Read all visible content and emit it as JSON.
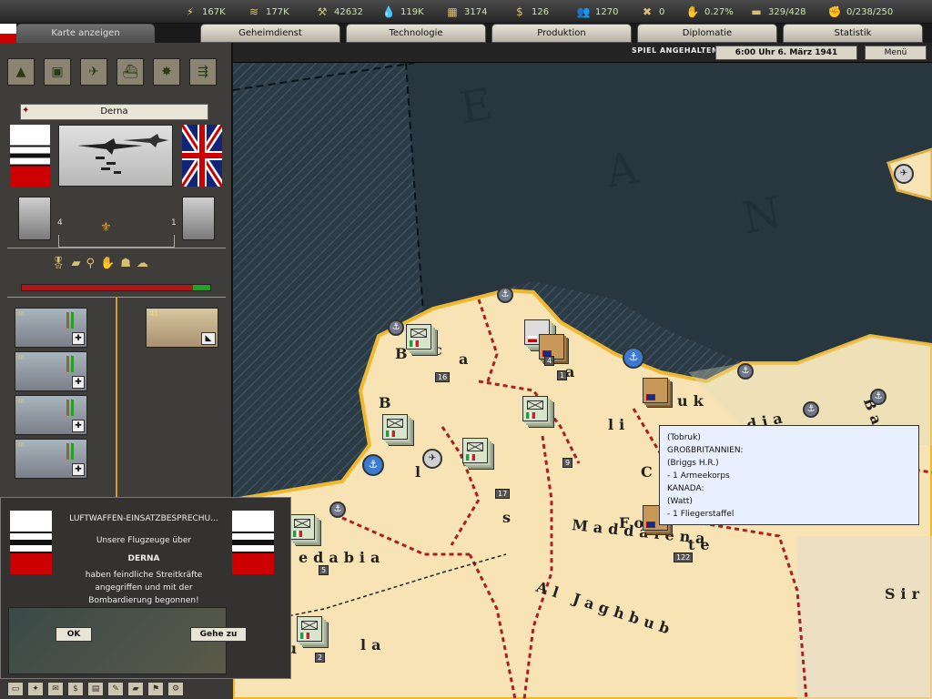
{
  "resources": [
    {
      "icon": "energy-icon",
      "glyph": "⚡",
      "value": "167K"
    },
    {
      "icon": "metal-icon",
      "glyph": "≋",
      "value": "177K"
    },
    {
      "icon": "rare-materials-icon",
      "glyph": "⚒",
      "value": "42632"
    },
    {
      "icon": "oil-icon",
      "glyph": "💧",
      "value": "119K"
    },
    {
      "icon": "supplies-icon",
      "glyph": "▦",
      "value": "3174"
    },
    {
      "icon": "money-icon",
      "glyph": "$",
      "value": "126"
    },
    {
      "icon": "manpower-icon",
      "glyph": "👥",
      "value": "1270"
    },
    {
      "icon": "diplomacy-icon",
      "glyph": "✖",
      "value": "0"
    },
    {
      "icon": "dissent-icon",
      "glyph": "✋",
      "value": "0.27%"
    },
    {
      "icon": "transport-icon",
      "glyph": "▬",
      "value": "329/428"
    },
    {
      "icon": "convoy-icon",
      "glyph": "✊",
      "value": "0/238/250"
    }
  ],
  "tabs": [
    "Karte anzeigen",
    "Geheimdienst",
    "Technologie",
    "Produktion",
    "Diplomatie",
    "Statistik"
  ],
  "status": {
    "paused": "SPIEL ANGEHALTEN",
    "clock": "6:00 Uhr 6. März 1941",
    "menu": "Menü"
  },
  "map_modes": [
    "terrain-map-icon",
    "land-unit-map-icon",
    "air-map-icon",
    "naval-map-icon",
    "bombing-map-icon",
    "supply-map-icon"
  ],
  "panel": {
    "province": "Derna",
    "left_leader_count": "4",
    "right_leader_count": "1",
    "air_units": [
      {
        "level": "III"
      },
      {
        "level": "III"
      },
      {
        "level": "III"
      },
      {
        "level": "III"
      }
    ],
    "infantry": {
      "strength": "41"
    },
    "hp_fraction": 0.91
  },
  "map": {
    "sea_letters": [
      "E",
      "A",
      "N"
    ],
    "regions": [
      "B",
      "c",
      "a",
      "a",
      "B",
      "l",
      "i",
      "li",
      "s",
      "C",
      "uk",
      "dia",
      "Fo",
      "te",
      "Maddalena",
      "edabia",
      "Al Jaghbub",
      "Au",
      "la",
      "Sir",
      "Ba"
    ],
    "unit_counts": [
      "16",
      "1",
      "4",
      "9",
      "17",
      "5",
      "122",
      "2"
    ]
  },
  "tooltip": [
    "(Tobruk)",
    "GROßBRITANNIEN:",
    "(Briggs H.R.)",
    "- 1 Armeekorps",
    "KANADA:",
    "(Watt)",
    "- 1 Fliegerstaffel"
  ],
  "dialog": {
    "title": "LUFTWAFFEN-EINSATZBESPRECHU...",
    "line1": "Unsere Flugzeuge über",
    "province": "DERNA",
    "line2": "haben feindliche Streitkräfte",
    "line3": "angegriffen und mit der",
    "line4": "Bombardierung begonnen!",
    "ok": "OK",
    "goto": "Gehe zu"
  }
}
